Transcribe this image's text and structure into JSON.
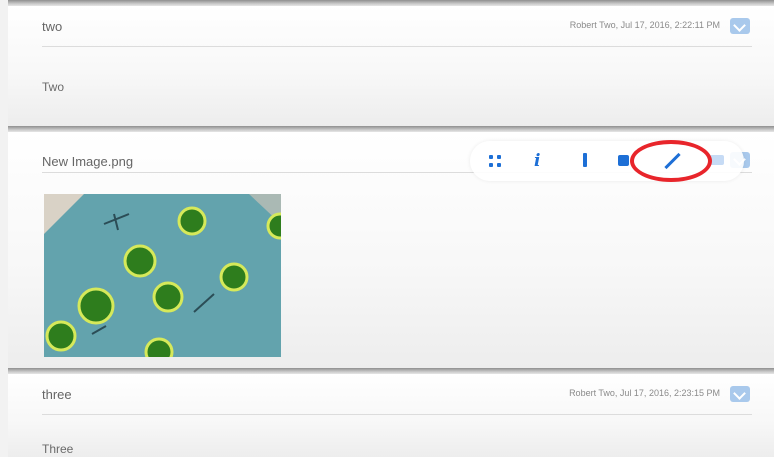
{
  "posts": [
    {
      "title": "two",
      "meta": "Robert Two, Jul 17, 2016, 2:22:11 PM",
      "body": "Two"
    },
    {
      "title": "New Image.png"
    },
    {
      "title": "three",
      "meta": "Robert Two, Jul 17, 2016, 2:23:15 PM",
      "body": "Three"
    }
  ],
  "toolbar": {
    "icons": [
      "grid-icon",
      "info-icon",
      "bar-icon",
      "share-icon",
      "pencil-icon",
      "dim-icon"
    ],
    "info_glyph": "i"
  },
  "colors": {
    "accent": "#1d6fd6",
    "highlight_circle": "#e8252b",
    "chevron": "#a9c9ec"
  }
}
